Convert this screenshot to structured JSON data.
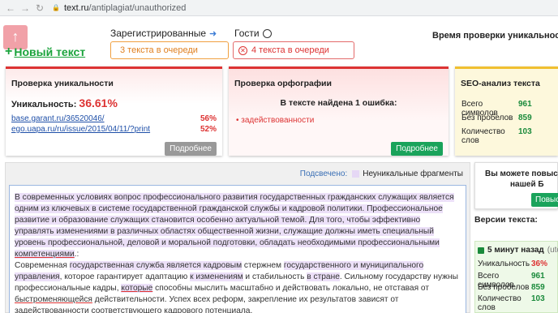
{
  "browser": {
    "url_host": "text.ru",
    "url_path": "/antiplagiat/unauthorized"
  },
  "header": {
    "up_arrow": "↑",
    "new_text": "Новый текст",
    "registered_label": "Зарегистрированные",
    "guests_label": "Гости",
    "registered_queue": "3 текста в очереди",
    "guests_queue": "4 текста в очереди",
    "check_time_label": "Время проверки уникальности:"
  },
  "uniqueness": {
    "title": "Проверка уникальности",
    "label": "Уникальность:",
    "value": "36.61%",
    "sources": [
      {
        "url": "base.garant.ru/36520046/",
        "percent": "56%"
      },
      {
        "url": "ego.uapa.ru/ru/issue/2015/04/11/?print",
        "percent": "52%"
      }
    ],
    "details_button": "Подробнее"
  },
  "spelling": {
    "title": "Проверка орфографии",
    "found": "В тексте найдена 1 ошибка:",
    "errors": [
      "задействованности"
    ],
    "details_button": "Подробнее"
  },
  "seo": {
    "title": "SEO-анализ текста",
    "rows": [
      {
        "label": "Всего символов",
        "value": "961"
      },
      {
        "label": "Без пробелов",
        "value": "859"
      },
      {
        "label": "Количество слов",
        "value": "103"
      }
    ]
  },
  "text_area": {
    "highlight_label": "Подсвечено:",
    "legend_label": "Неуникальные фрагменты"
  },
  "promo": {
    "line1": "Вы можете повыс",
    "line2": "нашей Б",
    "button": "Повыс"
  },
  "versions": {
    "title": "Версии текста:",
    "time": "5 минут назад",
    "tz": "(utc -",
    "rows": [
      {
        "label": "Уникальность",
        "value": "36%"
      },
      {
        "label": "Всего символов",
        "value": "961"
      },
      {
        "label": "Без пробелов",
        "value": "859"
      },
      {
        "label": "Количество слов",
        "value": "103"
      }
    ]
  },
  "colors": {
    "accent_green": "#1aa33b",
    "error_red": "#d33",
    "highlight": "#ece0f8"
  }
}
